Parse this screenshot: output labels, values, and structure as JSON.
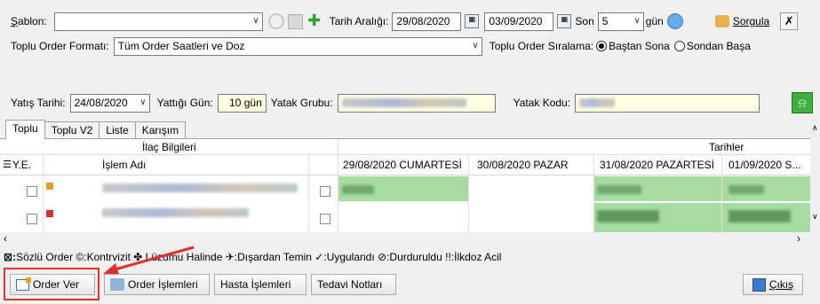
{
  "toolbar": {
    "template_label": "Şablon:",
    "template_value": "",
    "date_range_label": "Tarih Aralığı:",
    "date_from": "29/08/2020",
    "date_to": "03/09/2020",
    "last_label": "Son",
    "last_value": "5",
    "day_unit": "gün",
    "query_button": "Sorgula"
  },
  "format_row": {
    "format_label": "Toplu Order Formatı:",
    "format_value": "Tüm Order Saatleri ve Doz",
    "sort_label": "Toplu Order Sıralama:",
    "sort_option_1": "Baştan Sona",
    "sort_option_2": "Sondan Başa",
    "sort_selected": "Baştan Sona"
  },
  "admission_row": {
    "admission_date_label": "Yatış Tarihi:",
    "admission_date_value": "24/08/2020",
    "stay_days_label": "Yattığı Gün:",
    "stay_days_value": "10 gün",
    "ward_group_label": "Yatak Grubu:",
    "ward_group_value": "",
    "bed_code_label": "Yatak Kodu:",
    "bed_code_value": ""
  },
  "tabs": [
    {
      "label": "Toplu",
      "active": true
    },
    {
      "label": "Toplu V2",
      "active": false
    },
    {
      "label": "Liste",
      "active": false
    },
    {
      "label": "Karışım",
      "active": false
    }
  ],
  "grid": {
    "group_drug_info": "İlaç Bilgileri",
    "group_dates": "Tarihler",
    "col_ye": "Y.E.",
    "col_name": "İşlem Adı",
    "date_columns": [
      "29/08/2020 CUMARTESİ",
      "30/08/2020 PAZAR",
      "31/08/2020 PAZARTESİ",
      "01/09/2020 S..."
    ]
  },
  "legend": "Sözlü Order ©:Kontrvizit ✤ Lüzumu Halinde ✈:Dışardan Temin ✓:Uygulandı ⊘:Durduruldu !!:İlkdoz Acil",
  "legend_prefix": "⊠:",
  "buttons": {
    "order_ver": "Order Ver",
    "order_islemleri": "Order İşlemleri",
    "hasta_islemleri": "Hasta İşlemleri",
    "tedavi_notlari": "Tedavi Notları",
    "cikis": "Çıkış"
  },
  "colors": {
    "highlight": "#e03030",
    "applied_cell": "#a6dca0",
    "input_yellow": "#ffffe1"
  }
}
